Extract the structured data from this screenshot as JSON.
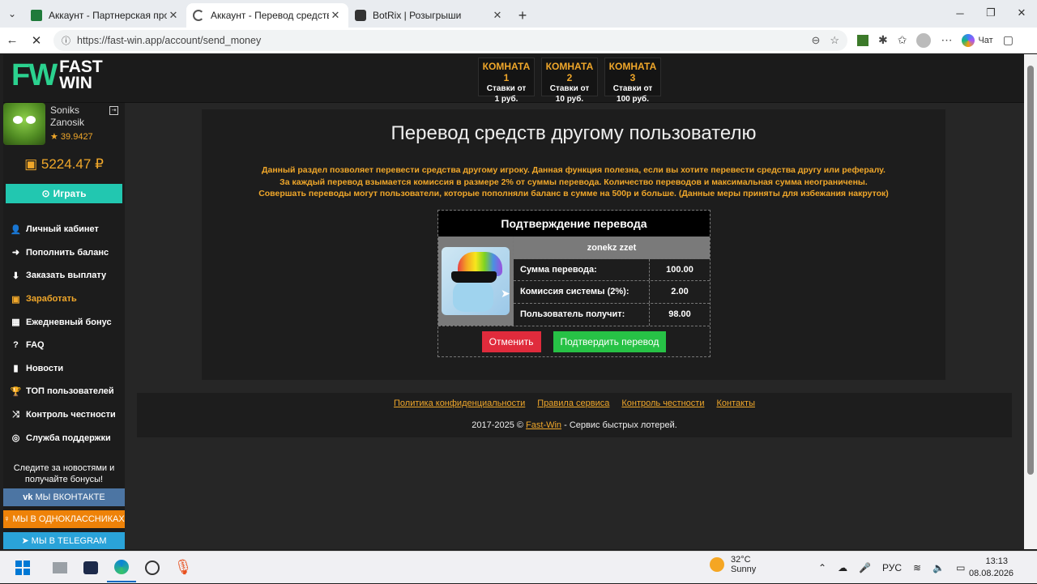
{
  "browser": {
    "tabs": [
      {
        "title": "Аккаунт - Партнерская програм",
        "active": false
      },
      {
        "title": "Аккаунт - Перевод средств",
        "active": true
      },
      {
        "title": "BotRix | Розыгрыши",
        "active": false
      }
    ],
    "url": "https://fast-win.app/account/send_money",
    "copilot_label": "Чат"
  },
  "header": {
    "logo_letters": "FW",
    "logo_line1": "FAST",
    "logo_line2": "WIN",
    "rooms": [
      {
        "name": "КОМНАТА 1",
        "sub1": "Ставки от",
        "sub2": "1 руб."
      },
      {
        "name": "КОМНАТА 2",
        "sub1": "Ставки от",
        "sub2": "10 руб."
      },
      {
        "name": "КОМНАТА 3",
        "sub1": "Ставки от",
        "sub2": "100 руб."
      }
    ]
  },
  "sidebar": {
    "user_line1": "Soniks",
    "user_line2": "Zanosik",
    "rating": "★ 39.9427",
    "balance": "5224.47 ₽",
    "play_label": "Играть",
    "menu": [
      {
        "label": "Личный кабинет",
        "icon": "user-icon",
        "glyph": "👤",
        "highlight": false
      },
      {
        "label": "Пополнить баланс",
        "icon": "arrow-right-circle-icon",
        "glyph": "➜",
        "highlight": false
      },
      {
        "label": "Заказать выплату",
        "icon": "arrow-down-circle-icon",
        "glyph": "⬇",
        "highlight": false
      },
      {
        "label": "Заработать",
        "icon": "money-icon",
        "glyph": "▣",
        "highlight": true
      },
      {
        "label": "Ежедневный бонус",
        "icon": "calendar-icon",
        "glyph": "▦",
        "highlight": false
      },
      {
        "label": "FAQ",
        "icon": "question-circle-icon",
        "glyph": "?",
        "highlight": false
      },
      {
        "label": "Новости",
        "icon": "bookmark-icon",
        "glyph": "▮",
        "highlight": false
      },
      {
        "label": "ТОП пользователей",
        "icon": "trophy-icon",
        "glyph": "🏆",
        "highlight": false
      },
      {
        "label": "Контроль честности",
        "icon": "shuffle-icon",
        "glyph": "⤨",
        "highlight": false
      },
      {
        "label": "Служба поддержки",
        "icon": "lifebuoy-icon",
        "glyph": "◎",
        "highlight": false
      }
    ],
    "follow_line1": "Следите за новостями и",
    "follow_line2": "получайте бонусы!",
    "social": {
      "vk": "МЫ ВКОНТАКТЕ",
      "ok": "МЫ В ОДНОКЛАССНИКАХ",
      "tg": "МЫ В TELEGRAM"
    }
  },
  "main": {
    "title": "Перевод средств другому пользователю",
    "notice_lines": [
      "Данный раздел позволяет перевести средства другому игроку. Данная функция полезна, если вы хотите перевести средства другу или рефералу.",
      "За каждый перевод взымается комиссия в размере 2% от суммы перевода. Количество переводов и максимальная сумма неограничены.",
      "Совершать переводы могут пользователи, которые пополняли баланс в сумме на 500р и больше. (Данные меры приняты для избежания накруток)"
    ],
    "confirm": {
      "heading": "Подтверждение перевода",
      "recipient": "zonekz zzet",
      "rows": [
        {
          "label": "Сумма перевода:",
          "value": "100.00"
        },
        {
          "label": "Комиссия системы (2%):",
          "value": "2.00"
        },
        {
          "label": "Пользователь получит:",
          "value": "98.00"
        }
      ],
      "cancel_label": "Отменить",
      "confirm_label": "Подтвердить перевод"
    }
  },
  "footer": {
    "links": [
      "Политика конфиденциальности",
      "Правила сервиса",
      "Контроль честности",
      "Контакты"
    ],
    "copyright_prefix": "2017-2025 ©",
    "copyright_link": "Fast-Win",
    "copyright_suffix": "- Сервис быстрых лотерей."
  },
  "taskbar": {
    "temperature": "32°C",
    "weather": "Sunny",
    "lang": "РУС",
    "time": "13:13",
    "date": "08.08.2026"
  },
  "colors": {
    "accent": "#f0a72a",
    "play": "#22c7b0",
    "cancel": "#e02b3c",
    "confirm": "#27c246"
  }
}
